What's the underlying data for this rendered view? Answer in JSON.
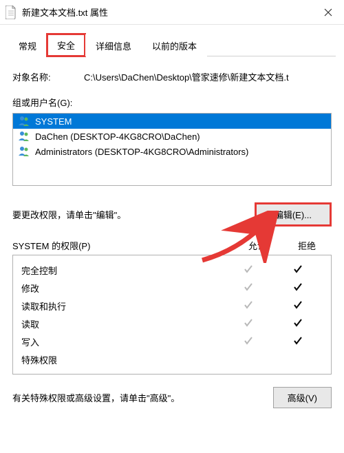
{
  "titlebar": {
    "title": "新建文本文档.txt 属性"
  },
  "tabs": {
    "general": "常规",
    "security": "安全",
    "details": "详细信息",
    "previous": "以前的版本"
  },
  "object": {
    "label": "对象名称:",
    "value": "C:\\Users\\DaChen\\Desktop\\管家速修\\新建文本文档.t"
  },
  "users": {
    "label": "组或用户名(G):",
    "list": [
      {
        "name": "SYSTEM",
        "selected": true
      },
      {
        "name": "DaChen (DESKTOP-4KG8CRO\\DaChen)",
        "selected": false
      },
      {
        "name": "Administrators (DESKTOP-4KG8CRO\\Administrators)",
        "selected": false
      }
    ]
  },
  "editHint": "要更改权限，请单击\"编辑\"。",
  "editButton": "编辑(E)...",
  "permissions": {
    "titlePrefix": "SYSTEM 的权限(P)",
    "allow": "允许",
    "deny": "拒绝",
    "rows": [
      {
        "name": "完全控制",
        "allow": true,
        "deny": true
      },
      {
        "name": "修改",
        "allow": true,
        "deny": true
      },
      {
        "name": "读取和执行",
        "allow": true,
        "deny": true
      },
      {
        "name": "读取",
        "allow": true,
        "deny": true
      },
      {
        "name": "写入",
        "allow": true,
        "deny": true
      },
      {
        "name": "特殊权限",
        "allow": false,
        "deny": false
      }
    ]
  },
  "advanced": {
    "hint": "有关特殊权限或高级设置，请单击\"高级\"。",
    "button": "高级(V)"
  }
}
